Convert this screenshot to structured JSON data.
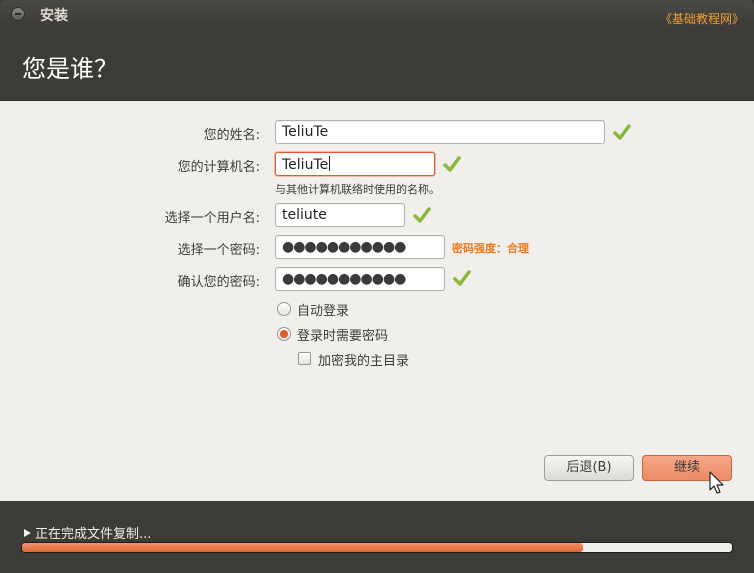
{
  "window": {
    "title": "安装",
    "watermark": "《基础教程网》"
  },
  "header": {
    "title": "您是谁？"
  },
  "form": {
    "name_label": "您的姓名:",
    "name_value": "TeliuTe",
    "computer_label": "您的计算机名:",
    "computer_value": "TeliuTe",
    "computer_hint": "与其他计算机联络时使用的名称。",
    "username_label": "选择一个用户名:",
    "username_value": "teliute",
    "password_label": "选择一个密码:",
    "password_value": "●●●●●●●●●●●",
    "password_strength": "密码强度：合理",
    "confirm_label": "确认您的密码:",
    "confirm_value": "●●●●●●●●●●●"
  },
  "options": {
    "auto_login": {
      "label": "自动登录",
      "selected": false
    },
    "require_password": {
      "label": "登录时需要密码",
      "selected": true
    },
    "encrypt_home": {
      "label": "加密我的主目录",
      "checked": false
    }
  },
  "buttons": {
    "back": "后退(B)",
    "next": "继续"
  },
  "footer": {
    "status": "正在完成文件复制...",
    "progress": 0.79
  },
  "colors": {
    "accent": "#e05a2a",
    "check": "#8ab83a",
    "strength": "#f07a1a",
    "dark_bg": "#3c3b37",
    "content_bg": "#f0efeb"
  }
}
